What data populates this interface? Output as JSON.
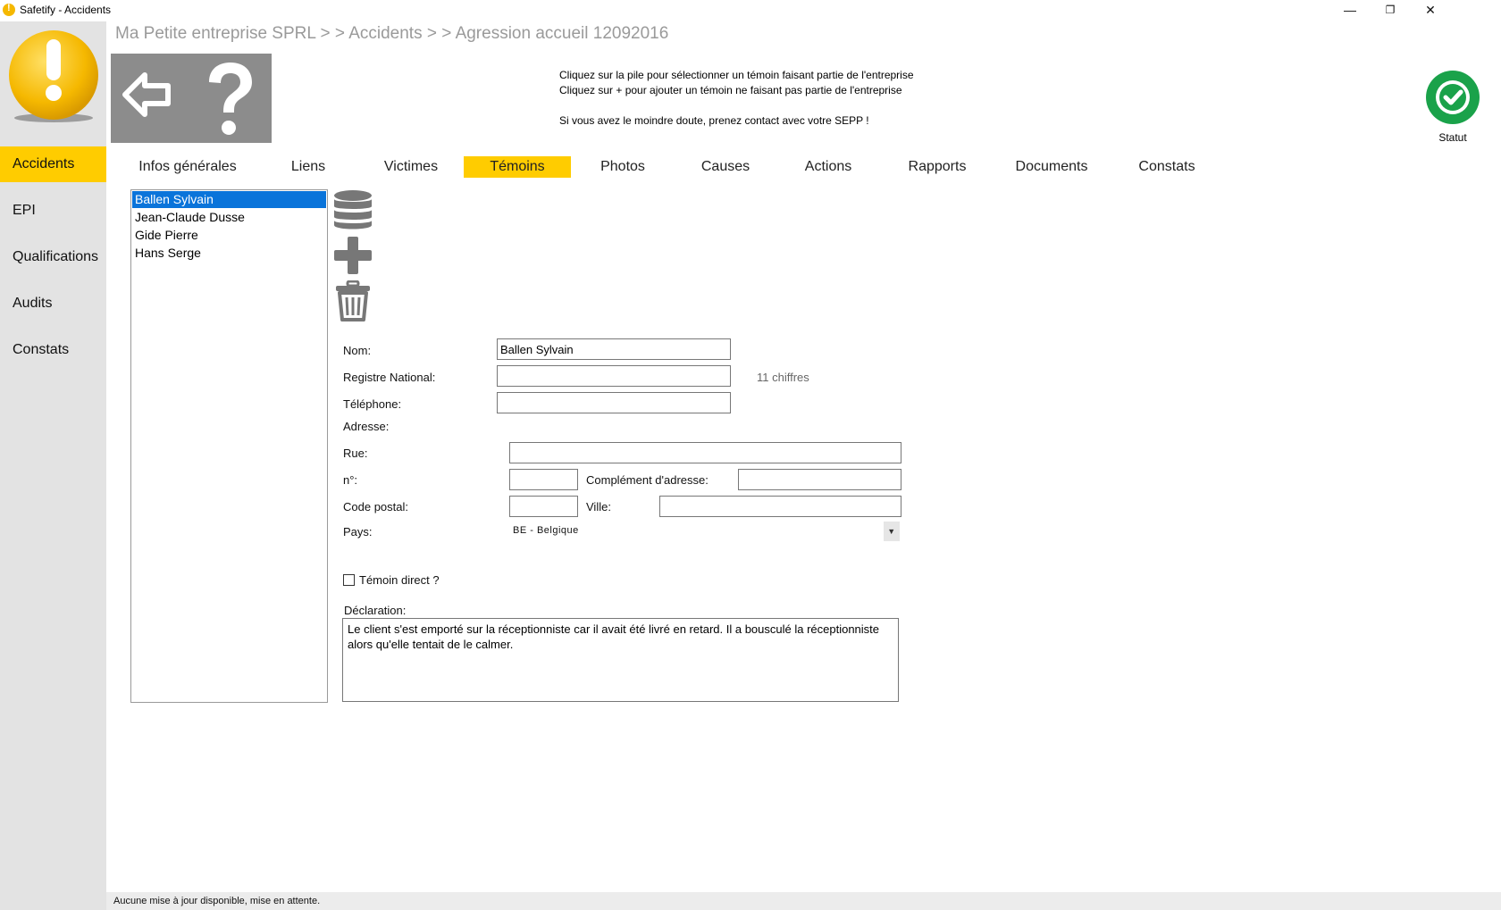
{
  "window": {
    "title": "Safetify - Accidents",
    "minimize_glyph": "—",
    "restore_glyph": "❐",
    "close_glyph": "✕"
  },
  "sidebar": {
    "items": [
      {
        "label": "Accidents",
        "active": true
      },
      {
        "label": "EPI",
        "active": false
      },
      {
        "label": "Qualifications",
        "active": false
      },
      {
        "label": "Audits",
        "active": false
      },
      {
        "label": "Constats",
        "active": false
      }
    ]
  },
  "header": {
    "breadcrumb": "Ma Petite entreprise SPRL > > Accidents > > Agression accueil 12092016",
    "instructions": {
      "line1": "Cliquez sur la pile pour sélectionner un témoin faisant partie de l'entreprise",
      "line2": "Cliquez sur + pour ajouter un témoin ne faisant pas partie de l'entreprise",
      "line3": "Si vous avez le moindre doute, prenez contact avec votre SEPP !"
    },
    "status_label": "Statut"
  },
  "tabs": [
    {
      "label": "Infos générales"
    },
    {
      "label": "Liens"
    },
    {
      "label": "Victimes"
    },
    {
      "label": "Témoins",
      "active": true
    },
    {
      "label": "Photos"
    },
    {
      "label": "Causes"
    },
    {
      "label": "Actions"
    },
    {
      "label": "Rapports"
    },
    {
      "label": "Documents"
    },
    {
      "label": "Constats"
    }
  ],
  "witnesses": [
    {
      "name": "Ballen Sylvain",
      "selected": true
    },
    {
      "name": "Jean-Claude Dusse"
    },
    {
      "name": "Gide Pierre"
    },
    {
      "name": "Hans Serge"
    }
  ],
  "form": {
    "nom_label": "Nom:",
    "nom_value": "Ballen Sylvain",
    "registre_label": "Registre National:",
    "registre_value": "",
    "registre_hint": "11 chiffres",
    "telephone_label": "Téléphone:",
    "telephone_value": "",
    "adresse_label": "Adresse:",
    "rue_label": "Rue:",
    "rue_value": "",
    "numero_label": "n°:",
    "numero_value": "",
    "complement_label": "Complément d'adresse:",
    "complement_value": "",
    "code_postal_label": "Code postal:",
    "code_postal_value": "",
    "ville_label": "Ville:",
    "ville_value": "",
    "pays_label": "Pays:",
    "pays_value": "BE - Belgique",
    "temoin_direct_label": "Témoin direct ?",
    "temoin_direct_checked": false,
    "declaration_label": "Déclaration:",
    "declaration_value": "Le client s'est emporté sur la réceptionniste car il avait été livré en retard. Il a bousculé la réceptionniste alors qu'elle tentait de le calmer."
  },
  "statusbar": {
    "message": "Aucune mise à jour disponible, mise en attente."
  },
  "colors": {
    "accent": "#ffcc00",
    "selection": "#0a74da",
    "status_ok": "#1aa24a",
    "sidebar_bg": "#e3e3e3"
  },
  "icons": [
    "app-logo-icon",
    "back-arrow-icon",
    "help-icon",
    "database-icon",
    "add-icon",
    "trash-icon",
    "status-check-icon",
    "dropdown-arrow-icon"
  ]
}
